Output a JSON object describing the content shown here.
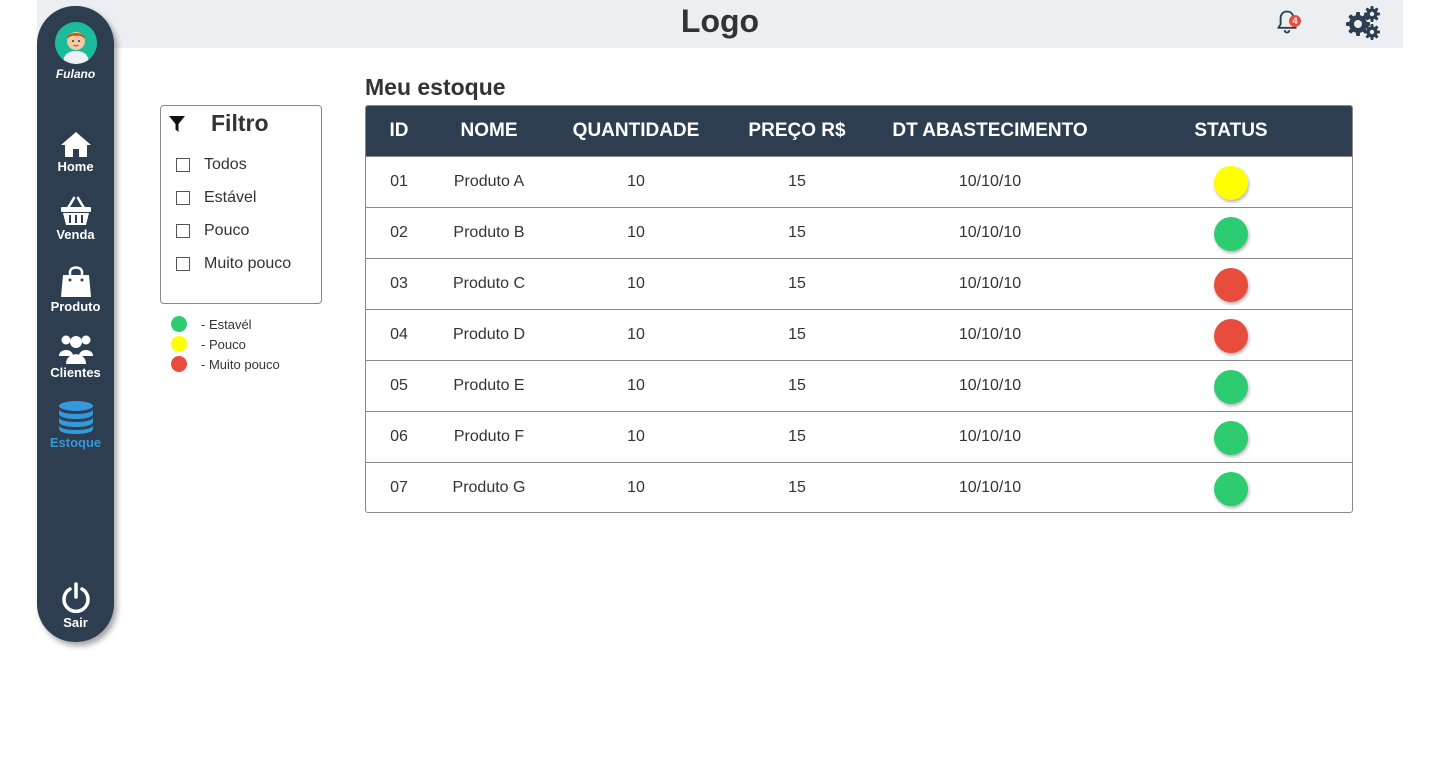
{
  "header": {
    "logo": "Logo",
    "notification_count": "4"
  },
  "user": {
    "name": "Fulano"
  },
  "nav": {
    "home": "Home",
    "venda": "Venda",
    "produto": "Produto",
    "clientes": "Clientes",
    "estoque": "Estoque",
    "sair": "Sair"
  },
  "filter": {
    "title": "Filtro",
    "options": [
      "Todos",
      "Estável",
      "Pouco",
      "Muito pouco"
    ]
  },
  "legend": [
    {
      "label": "- Estavél",
      "color": "#2ecc71"
    },
    {
      "label": "- Pouco",
      "color": "#ffff00"
    },
    {
      "label": "- Muito pouco",
      "color": "#e74c3c"
    }
  ],
  "page_title": "Meu estoque",
  "table": {
    "headers": [
      "ID",
      "NOME",
      "QUANTIDADE",
      "PREÇO R$",
      "DT ABASTECIMENTO",
      "STATUS"
    ],
    "rows": [
      {
        "id": "01",
        "nome": "Produto A",
        "quantidade": "10",
        "preco": "15",
        "data": "10/10/10",
        "status_color": "#ffff00"
      },
      {
        "id": "02",
        "nome": "Produto B",
        "quantidade": "10",
        "preco": "15",
        "data": "10/10/10",
        "status_color": "#2ecc71"
      },
      {
        "id": "03",
        "nome": "Produto C",
        "quantidade": "10",
        "preco": "15",
        "data": "10/10/10",
        "status_color": "#e74c3c"
      },
      {
        "id": "04",
        "nome": "Produto D",
        "quantidade": "10",
        "preco": "15",
        "data": "10/10/10",
        "status_color": "#e74c3c"
      },
      {
        "id": "05",
        "nome": "Produto E",
        "quantidade": "10",
        "preco": "15",
        "data": "10/10/10",
        "status_color": "#2ecc71"
      },
      {
        "id": "06",
        "nome": "Produto F",
        "quantidade": "10",
        "preco": "15",
        "data": "10/10/10",
        "status_color": "#2ecc71"
      },
      {
        "id": "07",
        "nome": "Produto G",
        "quantidade": "10",
        "preco": "15",
        "data": "10/10/10",
        "status_color": "#2ecc71"
      }
    ]
  },
  "colors": {
    "sidebar": "#2c3e50",
    "active": "#3498db",
    "topbar": "#eceff1"
  }
}
